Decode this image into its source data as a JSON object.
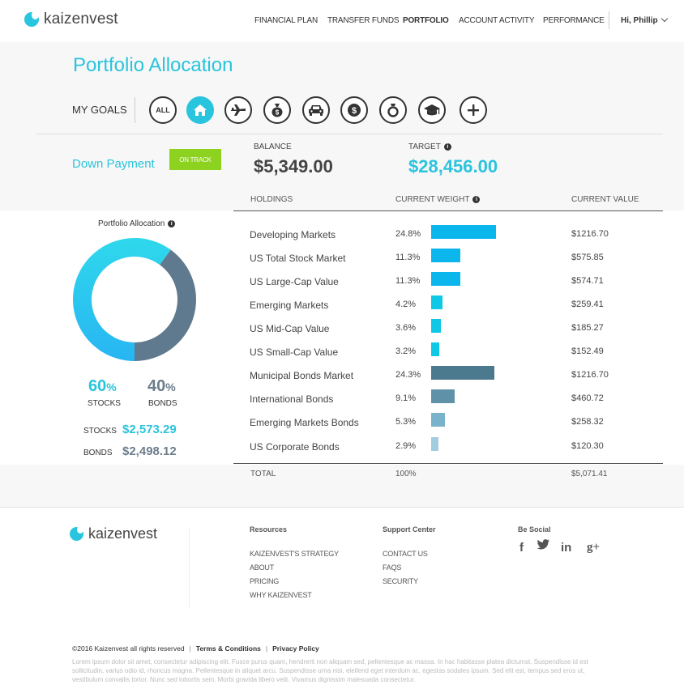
{
  "header": {
    "logo_text": "kaizenvest",
    "nav": [
      "FINANCIAL PLAN",
      "TRANSFER FUNDS",
      "PORTFOLIO",
      "ACCOUNT ACTIVITY",
      "PERFORMANCE"
    ],
    "active_nav": "PORTFOLIO",
    "user_greeting": "Hi, Phillip"
  },
  "page": {
    "title": "Portfolio Allocation"
  },
  "goals": {
    "label": "MY GOALS",
    "buttons": [
      {
        "label": "ALL",
        "icon": "all-text"
      },
      {
        "label": "",
        "icon": "home-icon",
        "selected": true
      },
      {
        "label": "",
        "icon": "plane-icon"
      },
      {
        "label": "",
        "icon": "money-bag-icon"
      },
      {
        "label": "",
        "icon": "car-icon"
      },
      {
        "label": "",
        "icon": "dollar-icon"
      },
      {
        "label": "",
        "icon": "ring-icon"
      },
      {
        "label": "",
        "icon": "graduation-cap-icon"
      },
      {
        "label": "",
        "icon": "plus-icon"
      }
    ]
  },
  "goal": {
    "name": "Down Payment",
    "status": "ON TRACK",
    "balance_label": "BALANCE",
    "balance": "$5,349.00",
    "target_label": "TARGET",
    "target": "$28,456.00"
  },
  "table": {
    "headers": [
      "HOLDINGS",
      "CURRENT WEIGHT",
      "CURRENT VALUE"
    ],
    "rows": [
      {
        "name": "Developing Markets",
        "weight": "24.8%",
        "weight_value": 24.8,
        "value": "$1216.70",
        "color": "#0ab6ec"
      },
      {
        "name": "US Total Stock Market",
        "weight": "11.3%",
        "weight_value": 11.3,
        "value": "$575.85",
        "color": "#0ab6ec"
      },
      {
        "name": "US Large-Cap Value",
        "weight": "11.3%",
        "weight_value": 11.3,
        "value": "$574.71",
        "color": "#0ab6ec"
      },
      {
        "name": "Emerging Markets",
        "weight": "4.2%",
        "weight_value": 4.2,
        "value": "$259.41",
        "color": "#0fc8e6"
      },
      {
        "name": "US Mid-Cap Value",
        "weight": "3.6%",
        "weight_value": 3.6,
        "value": "$185.27",
        "color": "#0fc8e6"
      },
      {
        "name": "US Small-Cap Value",
        "weight": "3.2%",
        "weight_value": 3.2,
        "value": "$152.49",
        "color": "#0fc8e6"
      },
      {
        "name": "Municipal Bonds Market",
        "weight": "24.3%",
        "weight_value": 24.3,
        "value": "$1216.70",
        "color": "#4b7a8e"
      },
      {
        "name": "International Bonds",
        "weight": "9.1%",
        "weight_value": 9.1,
        "value": "$460.72",
        "color": "#5f92a8"
      },
      {
        "name": "Emerging Markets Bonds",
        "weight": "5.3%",
        "weight_value": 5.3,
        "value": "$258.32",
        "color": "#7ab2cb"
      },
      {
        "name": "US Corporate Bonds",
        "weight": "2.9%",
        "weight_value": 2.9,
        "value": "$120.30",
        "color": "#a4cce0"
      }
    ],
    "total_label": "TOTAL",
    "total_weight": "100%",
    "total_value": "$5,071.41"
  },
  "allocation": {
    "title": "Portfolio Allocation",
    "stocks_pct": "60",
    "bonds_pct": "40",
    "pct_sign": "%",
    "stocks_label": "STOCKS",
    "bonds_label": "BONDS",
    "stocks_amount": "$2,573.29",
    "bonds_amount": "$2,498.12",
    "stocks_fraction": 0.6,
    "stocks_color": "#29c4dd",
    "bonds_color": "#5f7a8e"
  },
  "footer": {
    "logo_text": "kaizenvest",
    "resources_heading": "Resources",
    "resources": [
      "KAIZENVEST'S STRATEGY",
      "ABOUT",
      "PRICING",
      "WHY KAIZENVEST"
    ],
    "support_heading": "Support Center",
    "support": [
      "CONTACT US",
      "FAQS",
      "SECURITY"
    ],
    "social_heading": "Be Social",
    "social": [
      {
        "icon": "facebook-icon",
        "glyph": "f"
      },
      {
        "icon": "twitter-icon",
        "glyph": "🐦"
      },
      {
        "icon": "linkedin-icon",
        "glyph": "in"
      },
      {
        "icon": "google-plus-icon",
        "glyph": "g+"
      }
    ],
    "copyright": "©2016 Kaizenvest all rights reserved",
    "terms": "Terms & Conditions",
    "privacy": "Privacy Policy",
    "lorem": "Lorem ipsum dolor sit amet, consectetur adipiscing elit. Fusce purus quam, hendrerit non aliquam sed, pellentesque ac massa. In hac habitasse platea dictumst. Suspendisse id est sollicitudin, varius odio id, rhoncus magna. Pellentesque in aliquet arcu. Suspendisse urna nisi, eleifend eget interdum ac, egestas sodales ipsum. Sed elit est, tempus sed eros ut, vestibulum convallis tortor. Nunc sed lobortis sem. Morbi gravida libero velit. Vivamus dignissim malesuada consectetur."
  }
}
